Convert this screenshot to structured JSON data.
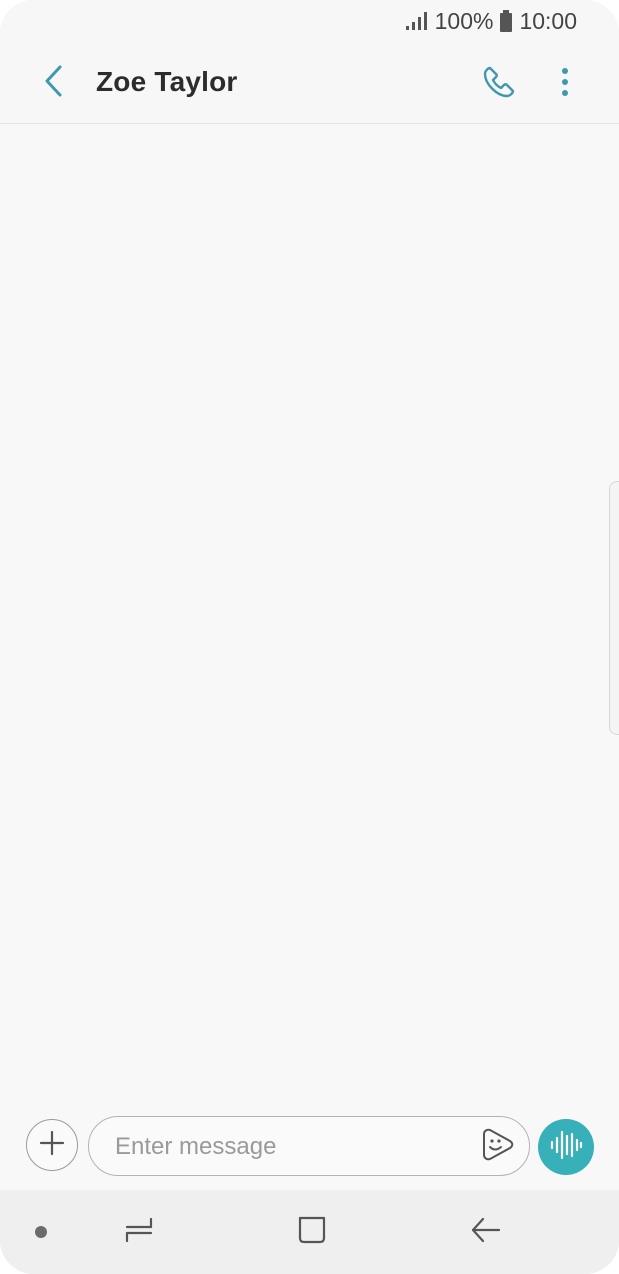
{
  "status_bar": {
    "battery_text": "100%",
    "time": "10:00",
    "signal_icon": "signal-bars-icon",
    "battery_icon": "battery-icon"
  },
  "header": {
    "contact_name": "Zoe Taylor",
    "back_icon": "chevron-left-icon",
    "call_icon": "phone-icon",
    "more_icon": "more-vertical-icon"
  },
  "composer": {
    "placeholder": "Enter message",
    "value": "",
    "attach_icon": "plus-icon",
    "sticker_icon": "sticker-icon",
    "voice_icon": "voice-wave-icon"
  },
  "nav_bar": {
    "dot_icon": "dot-icon",
    "recents_icon": "recents-icon",
    "home_icon": "home-icon",
    "back_icon": "back-arrow-icon"
  },
  "colors": {
    "accent": "#37b0ba",
    "title_text": "#2c2c2c",
    "background": "#f7f7f7"
  }
}
